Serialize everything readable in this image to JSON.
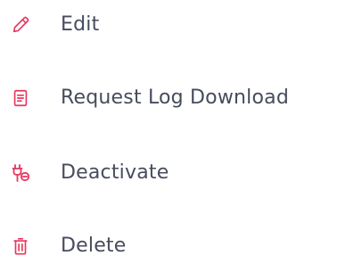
{
  "accent_color": "#e8365e",
  "text_color": "#474c5c",
  "menu": {
    "items": [
      {
        "label": "Edit",
        "icon": "pencil-icon"
      },
      {
        "label": "Request Log Download",
        "icon": "document-icon"
      },
      {
        "label": "Deactivate",
        "icon": "plug-off-icon"
      },
      {
        "label": "Delete",
        "icon": "trash-icon"
      }
    ]
  }
}
